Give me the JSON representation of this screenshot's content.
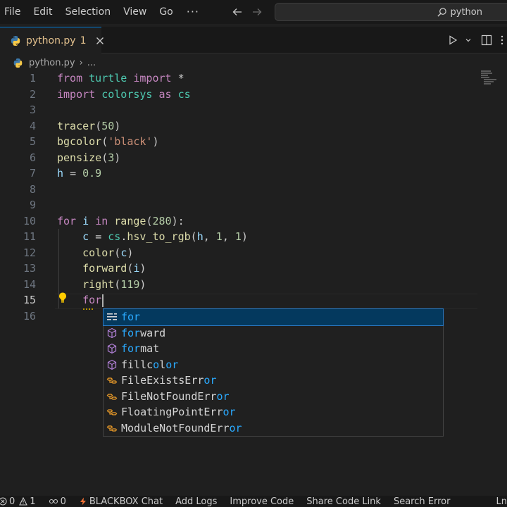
{
  "menu": {
    "items": [
      "File",
      "Edit",
      "Selection",
      "View",
      "Go"
    ],
    "more": "···"
  },
  "search": {
    "text": "python"
  },
  "tab": {
    "label": "python.py",
    "badge": "1"
  },
  "breadcrumb": {
    "file": "python.py",
    "rest": "..."
  },
  "code": {
    "line_numbers": [
      "1",
      "2",
      "3",
      "4",
      "5",
      "6",
      "7",
      "8",
      "9",
      "10",
      "11",
      "12",
      "13",
      "14",
      "15",
      "16"
    ],
    "l1": {
      "from": "from",
      "mod": "turtle",
      "import": "import",
      "star": "*"
    },
    "l2": {
      "import": "import",
      "mod": "colorsys",
      "as": "as",
      "alias": "cs"
    },
    "l4": {
      "fn": "tracer",
      "arg": "50"
    },
    "l5": {
      "fn": "bgcolor",
      "arg": "'black'"
    },
    "l6": {
      "fn": "pensize",
      "arg": "3"
    },
    "l7": {
      "var": "h",
      "op": "=",
      "val": "0.9"
    },
    "l10": {
      "for": "for",
      "var": "i",
      "in": "in",
      "fn": "range",
      "arg": "280"
    },
    "l11": {
      "var": "c",
      "op": "=",
      "mod": "cs",
      "fn": "hsv_to_rgb",
      "a1": "h",
      "a2": "1",
      "a3": "1"
    },
    "l12": {
      "fn": "color",
      "arg": "c"
    },
    "l13": {
      "fn": "forward",
      "arg": "i"
    },
    "l14": {
      "fn": "right",
      "arg": "119"
    },
    "l15": {
      "typed": "for"
    }
  },
  "suggest": {
    "items": [
      {
        "kind": "keyword",
        "hl": "for",
        "rest": ""
      },
      {
        "kind": "method",
        "hl": "for",
        "rest": "ward"
      },
      {
        "kind": "method",
        "hl": "for",
        "rest": "mat"
      },
      {
        "kind": "method",
        "pre": "fillc",
        "hl2": "o",
        "mid": "l",
        "hl3": "or"
      },
      {
        "kind": "class",
        "text": "FileExistsErr",
        "tail": "or"
      },
      {
        "kind": "class",
        "text": "FileNotFoundErr",
        "tail": "or"
      },
      {
        "kind": "class",
        "text": "FloatingPointErr",
        "tail": "or"
      },
      {
        "kind": "class",
        "text": "ModuleNotFoundErr",
        "tail": "or"
      }
    ]
  },
  "status": {
    "errors": "0",
    "warnings": "1",
    "ports": "0",
    "blackbox": "BLACKBOX Chat",
    "add_logs": "Add Logs",
    "improve": "Improve Code",
    "share": "Share Code Link",
    "search_error": "Search Error",
    "ln": "Ln"
  }
}
